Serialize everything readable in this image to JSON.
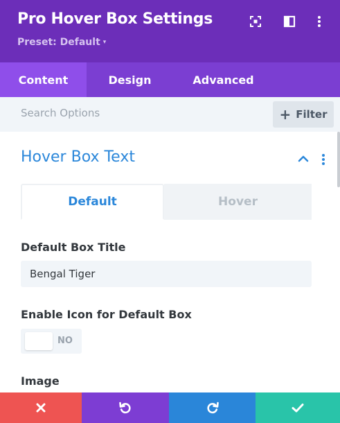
{
  "header": {
    "title": "Pro Hover Box Settings",
    "preset_label": "Preset: Default",
    "preset_caret": "▾",
    "icons": [
      "expand-icon",
      "sidebar-layout-icon",
      "more-vertical-icon"
    ],
    "bg_color": "#6c2eb9"
  },
  "tabs": [
    {
      "label": "Content",
      "active": true
    },
    {
      "label": "Design",
      "active": false
    },
    {
      "label": "Advanced",
      "active": false
    }
  ],
  "search": {
    "placeholder": "Search Options",
    "value": "",
    "filter_label": "Filter"
  },
  "section": {
    "title": "Hover Box Text",
    "expanded": true,
    "accent_color": "#2b87da"
  },
  "subtabs": [
    {
      "label": "Default",
      "active": true
    },
    {
      "label": "Hover",
      "active": false
    }
  ],
  "fields": {
    "box_title_label": "Default Box Title",
    "box_title_value": "Bengal Tiger",
    "enable_icon_label": "Enable Icon for Default Box",
    "enable_icon_toggle_text": "NO",
    "image_label": "Image"
  },
  "footer": {
    "buttons": [
      {
        "name": "discard-button",
        "icon": "close-icon",
        "color": "#ee5452"
      },
      {
        "name": "undo-button",
        "icon": "undo-icon",
        "color": "#7d3dd3"
      },
      {
        "name": "redo-button",
        "icon": "redo-icon",
        "color": "#2a86d9"
      },
      {
        "name": "save-button",
        "icon": "check-icon",
        "color": "#29c4a9"
      }
    ]
  }
}
